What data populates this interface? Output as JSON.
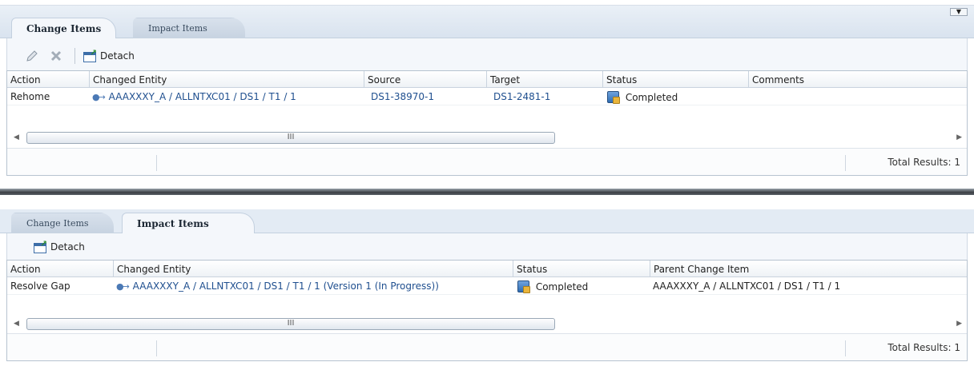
{
  "top_panel": {
    "tabs": [
      {
        "label": "Change Items",
        "active": true
      },
      {
        "label": "Impact Items",
        "active": false
      }
    ],
    "toolbar": {
      "edit_icon": "pencil-icon",
      "delete_icon": "delete-x-icon",
      "detach_label": "Detach"
    },
    "columns": [
      "Action",
      "Changed Entity",
      "Source",
      "Target",
      "Status",
      "Comments"
    ],
    "rows": [
      {
        "action": "Rehome",
        "changed_entity": "AAAXXXY_A / ALLNTXC01 / DS1 / T1 / 1",
        "source": "DS1-38970-1",
        "target": "DS1-2481-1",
        "status": "Completed",
        "comments": ""
      }
    ],
    "scroll_grip": "III",
    "total_results": "Total Results: 1"
  },
  "bottom_panel": {
    "tabs": [
      {
        "label": "Change Items",
        "active": false
      },
      {
        "label": "Impact Items",
        "active": true
      }
    ],
    "toolbar": {
      "detach_label": "Detach"
    },
    "columns": [
      "Action",
      "Changed Entity",
      "Status",
      "Parent Change Item"
    ],
    "rows": [
      {
        "action": "Resolve Gap",
        "changed_entity": "AAAXXXY_A / ALLNTXC01 / DS1 / T1 / 1 (Version 1 (In Progress))",
        "status": "Completed",
        "parent_change_item": "AAAXXXY_A / ALLNTXC01 / DS1 / T1 / 1"
      }
    ],
    "scroll_grip": "III",
    "total_results": "Total Results: 1"
  },
  "colors": {
    "link": "#1f4f8f",
    "tab_bar": "#d9e3ef",
    "divider": "#3b3f44"
  }
}
